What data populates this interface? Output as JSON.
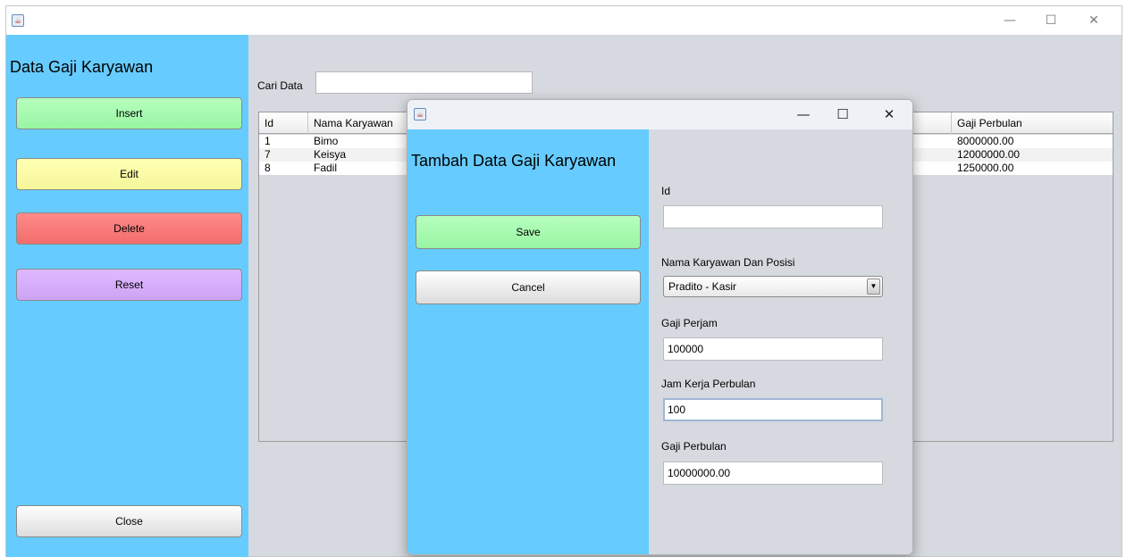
{
  "main_window": {
    "sidebar": {
      "title": "Data Gaji Karyawan",
      "buttons": {
        "insert": "Insert",
        "edit": "Edit",
        "delete": "Delete",
        "reset": "Reset",
        "close": "Close"
      }
    },
    "search": {
      "label": "Cari Data",
      "value": ""
    },
    "table": {
      "columns": [
        "Id",
        "Nama Karyawan",
        "Gaji Perbulan"
      ],
      "rows": [
        {
          "id": "1",
          "nama": "Bimo",
          "gaji_perbulan": "8000000.00"
        },
        {
          "id": "7",
          "nama": "Keisya",
          "gaji_perbulan": "12000000.00"
        },
        {
          "id": "8",
          "nama": "Fadil",
          "gaji_perbulan": "1250000.00"
        }
      ]
    },
    "controls": {
      "minimize": "—",
      "maximize": "☐",
      "close": "✕"
    }
  },
  "dialog": {
    "title": "Tambah Data Gaji Karyawan",
    "controls": {
      "minimize": "—",
      "maximize": "☐",
      "close": "✕"
    },
    "buttons": {
      "save": "Save",
      "cancel": "Cancel"
    },
    "fields": {
      "id": {
        "label": "Id",
        "value": ""
      },
      "nama_posisi": {
        "label": "Nama Karyawan Dan Posisi",
        "selected": "Pradito - Kasir"
      },
      "gaji_perjam": {
        "label": "Gaji Perjam",
        "value": "100000"
      },
      "jam_kerja": {
        "label": "Jam Kerja Perbulan",
        "value": "100"
      },
      "gaji_perbulan": {
        "label": "Gaji Perbulan",
        "value": "10000000.00"
      }
    }
  },
  "icons": {
    "app_icon": "java-cup-icon",
    "dropdown": "triangle-down-icon"
  },
  "colors": {
    "sidebar": "#66ccff",
    "insert": "#a8ffb0",
    "edit": "#ffffa8",
    "delete": "#ff7a7a",
    "reset": "#d9b0ff",
    "background": "#d6d9df"
  }
}
